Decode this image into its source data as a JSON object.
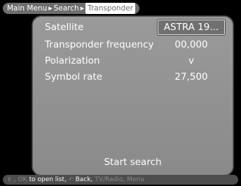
{
  "breadcrumb": {
    "items": [
      "Main Menu",
      "Search",
      "Transponder"
    ]
  },
  "settings": {
    "rows": [
      {
        "label": "Satellite",
        "value": "ASTRA 19..."
      },
      {
        "label": "Transponder frequency",
        "value": "00,000"
      },
      {
        "label": "Polarization",
        "value": "v"
      },
      {
        "label": "Symbol rate",
        "value": "27,500"
      }
    ],
    "start_search": "Start search"
  },
  "footer": {
    "updown_icon": "up-down-arrows-icon",
    "ok_text": "OK",
    "to_open_list": "to open list,",
    "back_icon": "back-arrow-icon",
    "back_text": "Back,",
    "tv_radio": "TV/Radio,",
    "menu": "Menu"
  },
  "colors": {
    "panel": "#8f8f8f",
    "breadcrumb_bg": "#6e6e6e",
    "footer_bg": "#4d4d4d",
    "selected_box": "#707070"
  }
}
